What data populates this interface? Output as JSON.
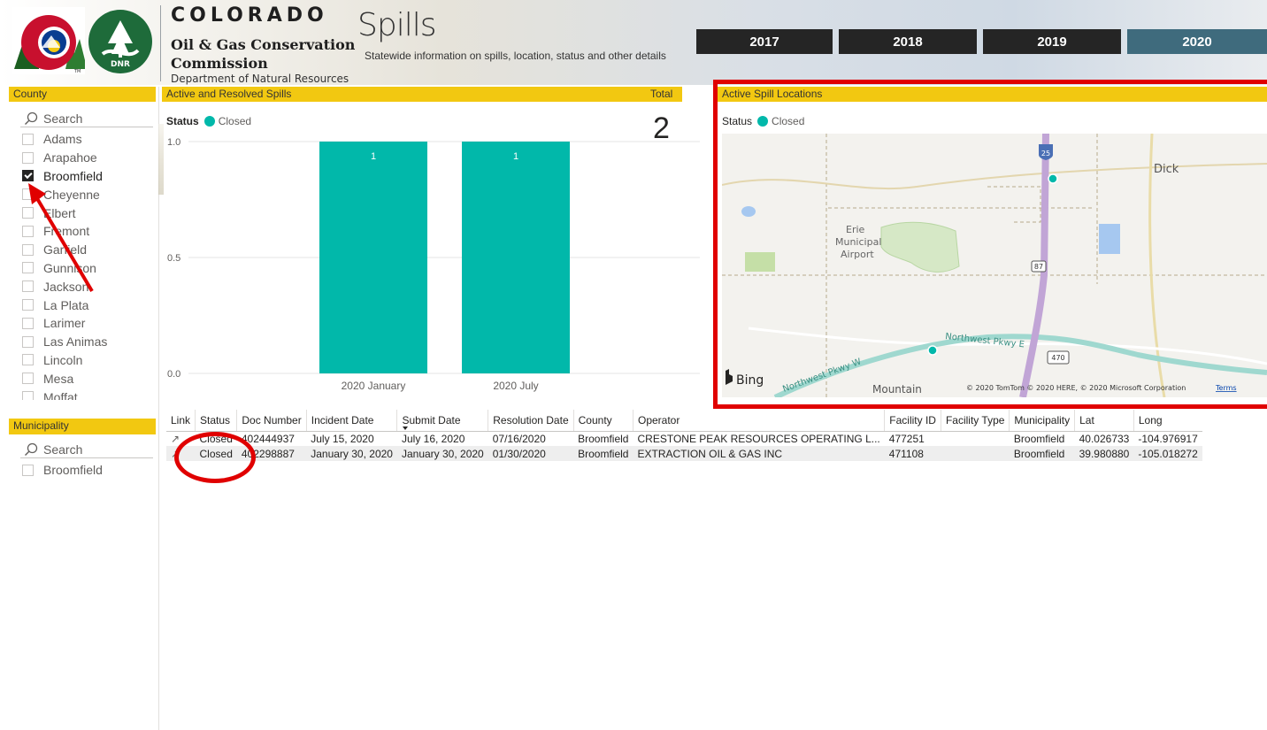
{
  "header": {
    "co_word": "COLORADO",
    "org_line1": "Oil & Gas Conservation",
    "org_line2": "Commission",
    "dept": "Department of Natural Resources",
    "title": "Spills",
    "subtitle": "Statewide information on spills, location, status and other details",
    "dnr_badge": "DNR",
    "years": [
      {
        "label": "2017",
        "selected": false
      },
      {
        "label": "2018",
        "selected": false
      },
      {
        "label": "2019",
        "selected": false
      },
      {
        "label": "2020",
        "selected": true
      }
    ]
  },
  "county": {
    "title": "County",
    "search_placeholder": "Search",
    "items": [
      {
        "label": "Adams",
        "checked": false
      },
      {
        "label": "Arapahoe",
        "checked": false
      },
      {
        "label": "Broomfield",
        "checked": true
      },
      {
        "label": "Cheyenne",
        "checked": false
      },
      {
        "label": "Elbert",
        "checked": false
      },
      {
        "label": "Fremont",
        "checked": false
      },
      {
        "label": "Garfield",
        "checked": false
      },
      {
        "label": "Gunnison",
        "checked": false
      },
      {
        "label": "Jackson",
        "checked": false
      },
      {
        "label": "La Plata",
        "checked": false
      },
      {
        "label": "Larimer",
        "checked": false
      },
      {
        "label": "Las Animas",
        "checked": false
      },
      {
        "label": "Lincoln",
        "checked": false
      },
      {
        "label": "Mesa",
        "checked": false
      },
      {
        "label": "Moffat",
        "checked": false
      }
    ]
  },
  "municipality": {
    "title": "Municipality",
    "search_placeholder": "Search",
    "items": [
      {
        "label": "Broomfield",
        "checked": false
      }
    ]
  },
  "spills_chart": {
    "title": "Active and Resolved Spills",
    "total_label": "Total",
    "total_value": "2",
    "legend_title": "Status",
    "legend_item": "Closed",
    "color": "#01b8aa"
  },
  "chart_data": {
    "type": "bar",
    "categories": [
      "2020 January",
      "2020 July"
    ],
    "series": [
      {
        "name": "Closed",
        "values": [
          1,
          1
        ]
      }
    ],
    "data_labels": [
      "1",
      "1"
    ],
    "y_ticks": [
      "0.0",
      "0.5",
      "1.0"
    ],
    "ylim": [
      0,
      1
    ],
    "grid": true,
    "legend": "top-left"
  },
  "map": {
    "title": "Active Spill Locations",
    "legend_title": "Status",
    "legend_item": "Closed",
    "labels": {
      "dick": "Dick",
      "erie1": "Erie",
      "erie2": "Municipal",
      "erie3": "Airport",
      "shield25": "25",
      "shield87": "87",
      "shield470": "470",
      "nw_e": "Northwest Pkwy E",
      "nw_w": "Northwest Pkwy W",
      "mountain": "Mountain"
    },
    "bing": "Bing",
    "copyright": "© 2020 TomTom © 2020 HERE, © 2020 Microsoft Corporation",
    "terms": "Terms"
  },
  "table": {
    "headers": [
      "Link",
      "Status",
      "Doc Number",
      "Incident Date",
      "Submit Date",
      "Resolution Date",
      "County",
      "Operator",
      "Facility ID",
      "Facility Type",
      "Municipality",
      "Lat",
      "Long"
    ],
    "rows": [
      {
        "status": "Closed",
        "doc": "402444937",
        "incident": "July 15, 2020",
        "submit": "July 16, 2020",
        "resolution": "07/16/2020",
        "county": "Broomfield",
        "operator": "CRESTONE PEAK RESOURCES OPERATING L...",
        "facility_id": "477251",
        "facility_type": "",
        "municipality": "Broomfield",
        "lat": "40.026733",
        "long": "-104.976917"
      },
      {
        "status": "Closed",
        "doc": "402298887",
        "incident": "January 30, 2020",
        "submit": "January 30, 2020",
        "resolution": "01/30/2020",
        "county": "Broomfield",
        "operator": "EXTRACTION OIL & GAS INC",
        "facility_id": "471108",
        "facility_type": "",
        "municipality": "Broomfield",
        "lat": "39.980880",
        "long": "-105.018272"
      }
    ]
  }
}
